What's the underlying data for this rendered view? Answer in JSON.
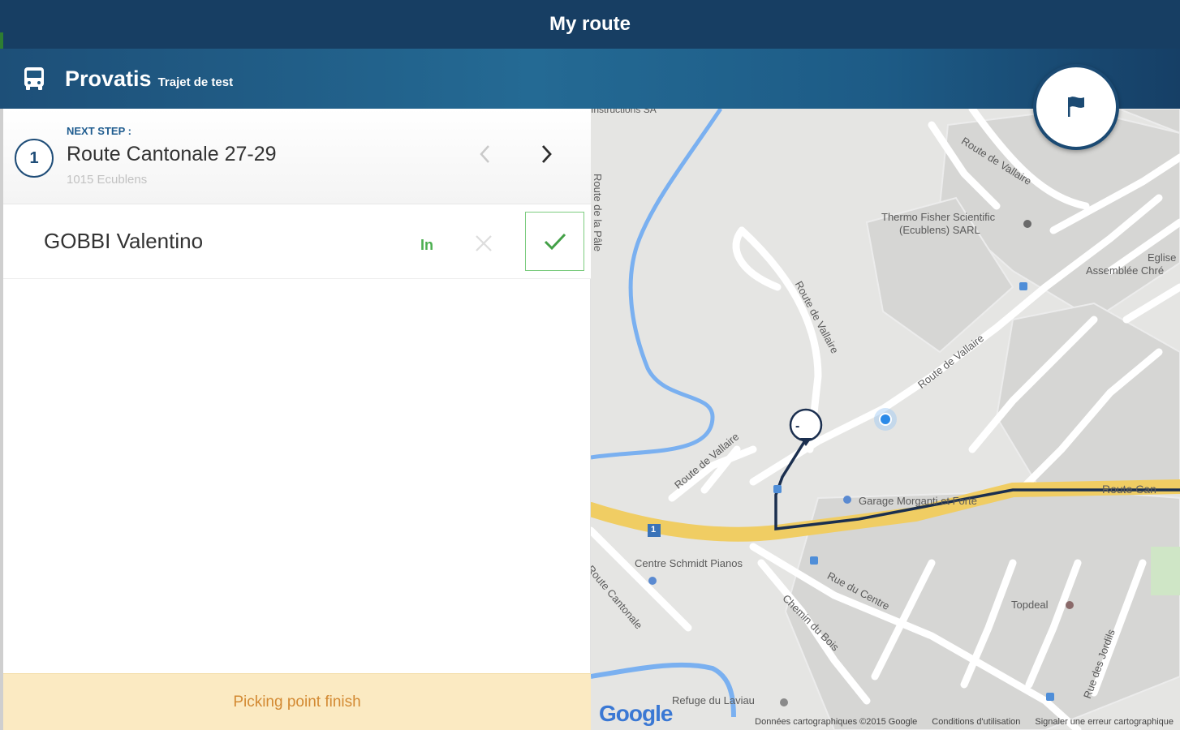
{
  "header": {
    "title": "My route"
  },
  "subheader": {
    "brand": "Provatis",
    "route_name": "Trajet de test"
  },
  "next_step": {
    "label": "NEXT STEP :",
    "number": "1",
    "address": "Route Cantonale 27-29",
    "city": "1015 Ecublens"
  },
  "passenger": {
    "name": "GOBBI Valentino",
    "status": "In"
  },
  "footer": {
    "finish_label": "Picking point finish"
  },
  "map": {
    "labels": {
      "route_vallaire_top": "Route de Vallaire",
      "route_vallaire_mid": "Route de Vallaire",
      "route_vallaire_ne": "Route de Vallaire",
      "route_vallaire_sw": "Route de Vallaire",
      "route_cantonale_sw": "Route Cantonale",
      "route_cantonale_e": "Route Can",
      "rue_centre": "Rue du Centre",
      "chemin_bois": "Chemin du Bois",
      "rue_jordils": "Rue des Jordils",
      "route_praille": "Route de la Pâle",
      "instructions": "Instructions SA",
      "thermo_1": "Thermo Fisher Scientific",
      "thermo_2": "(Ecublens) SARL",
      "eglise_1": "Eglise E",
      "eglise_2": "Assemblée Chré",
      "garage": "Garage Morganti et Forte",
      "schmidt": "Centre Schmidt Pianos",
      "topdeal": "Topdeal",
      "refuge": "Refuge du Laviau",
      "marker_label": "-",
      "highway_shield": "1"
    },
    "google": "Google",
    "footer_data": "Données cartographiques ©2015 Google",
    "footer_terms": "Conditions d'utilisation",
    "footer_report": "Signaler une erreur cartographique"
  },
  "colors": {
    "header": "#173e63",
    "accent": "#1f4d78",
    "success": "#4caf50",
    "footer_bg": "#fbeac2",
    "footer_text": "#d38a33",
    "map_bg": "#e5e5e3",
    "highway": "#f0cd63",
    "river": "#7ab0f0"
  },
  "icons": {
    "bus": "bus-icon",
    "prev": "chevron-left-icon",
    "next": "chevron-right-icon",
    "cancel": "close-icon",
    "confirm": "check-icon",
    "flag": "flag-icon",
    "location": "location-dot-icon"
  }
}
